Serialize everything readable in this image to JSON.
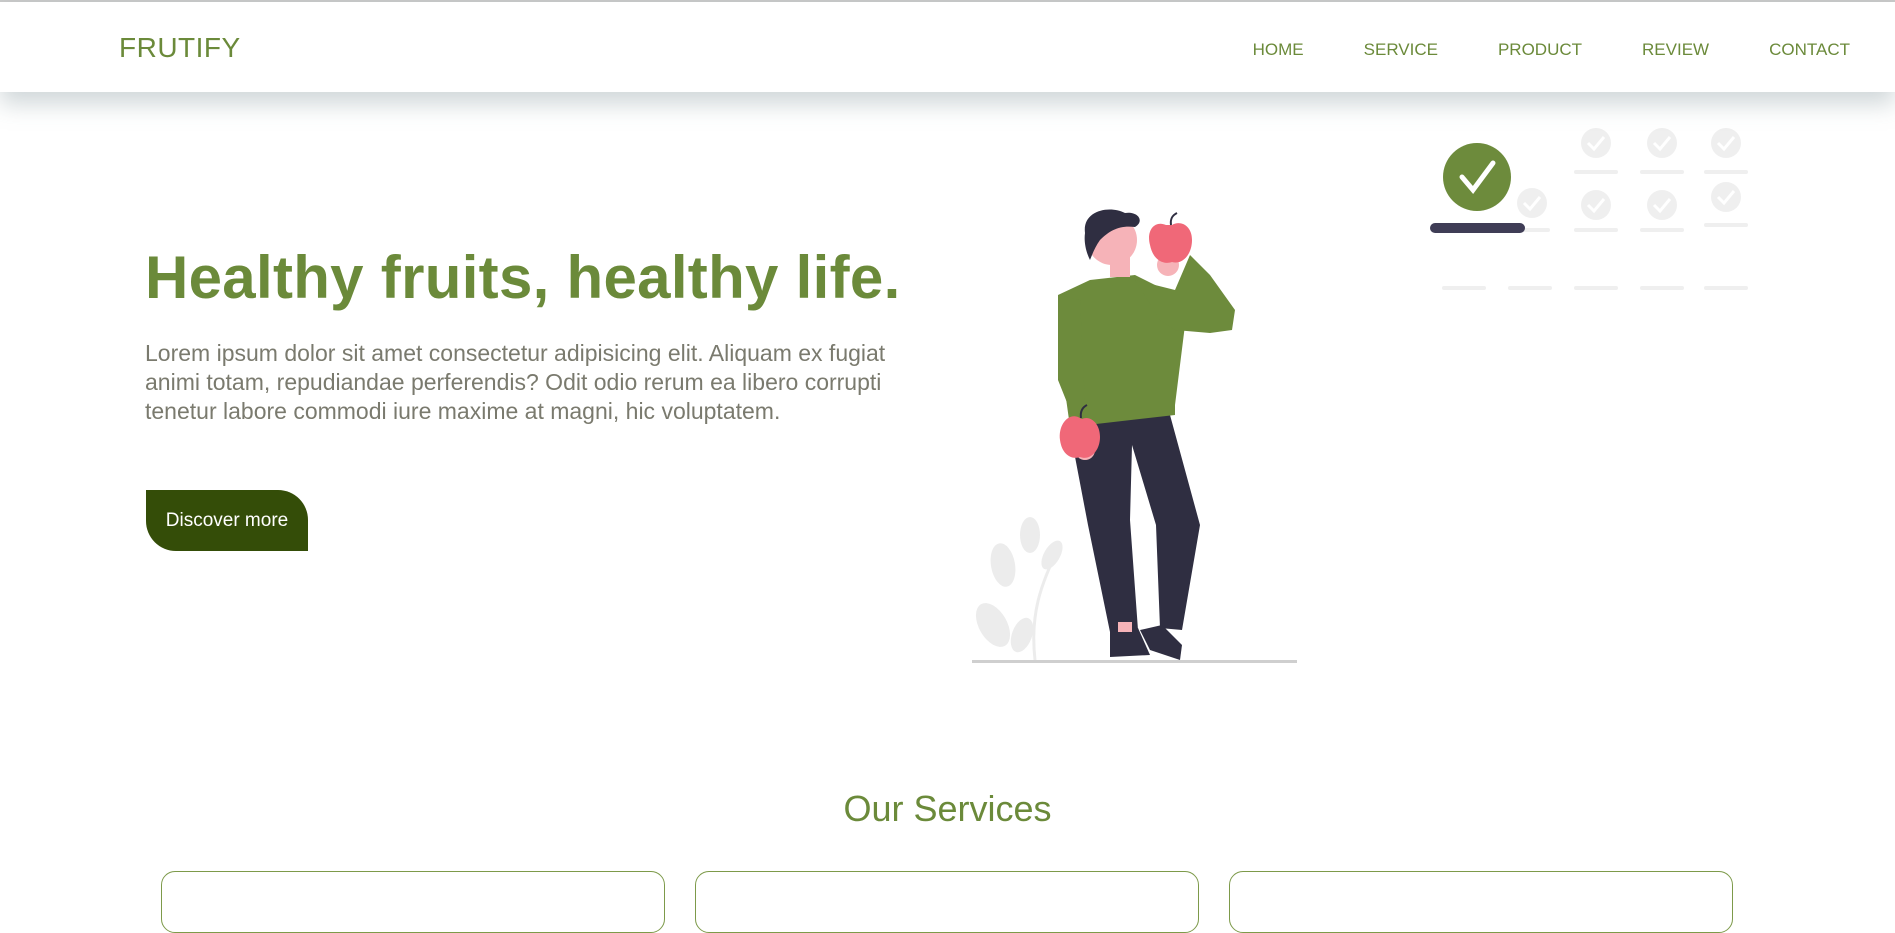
{
  "brand": {
    "name": "FRUTIFY"
  },
  "nav": {
    "items": [
      "HOME",
      "SERVICE",
      "PRODUCT",
      "REVIEW",
      "CONTACT"
    ]
  },
  "hero": {
    "title": "Healthy fruits, healthy life.",
    "description": "Lorem ipsum dolor sit amet consectetur adipisicing elit. Aliquam ex fugiat animi totam, repudiandae perferendis? Odit odio rerum ea libero corrupti tenetur labore commodi iure maxime at magni, hic voluptatem.",
    "cta_label": "Discover more"
  },
  "services": {
    "title": "Our Services"
  },
  "colors": {
    "brand_green": "#6b8a3a",
    "dark_green": "#344d08",
    "apple_red": "#f06878",
    "pants": "#2f2e41"
  },
  "icons": [
    "check-circle-icon"
  ]
}
